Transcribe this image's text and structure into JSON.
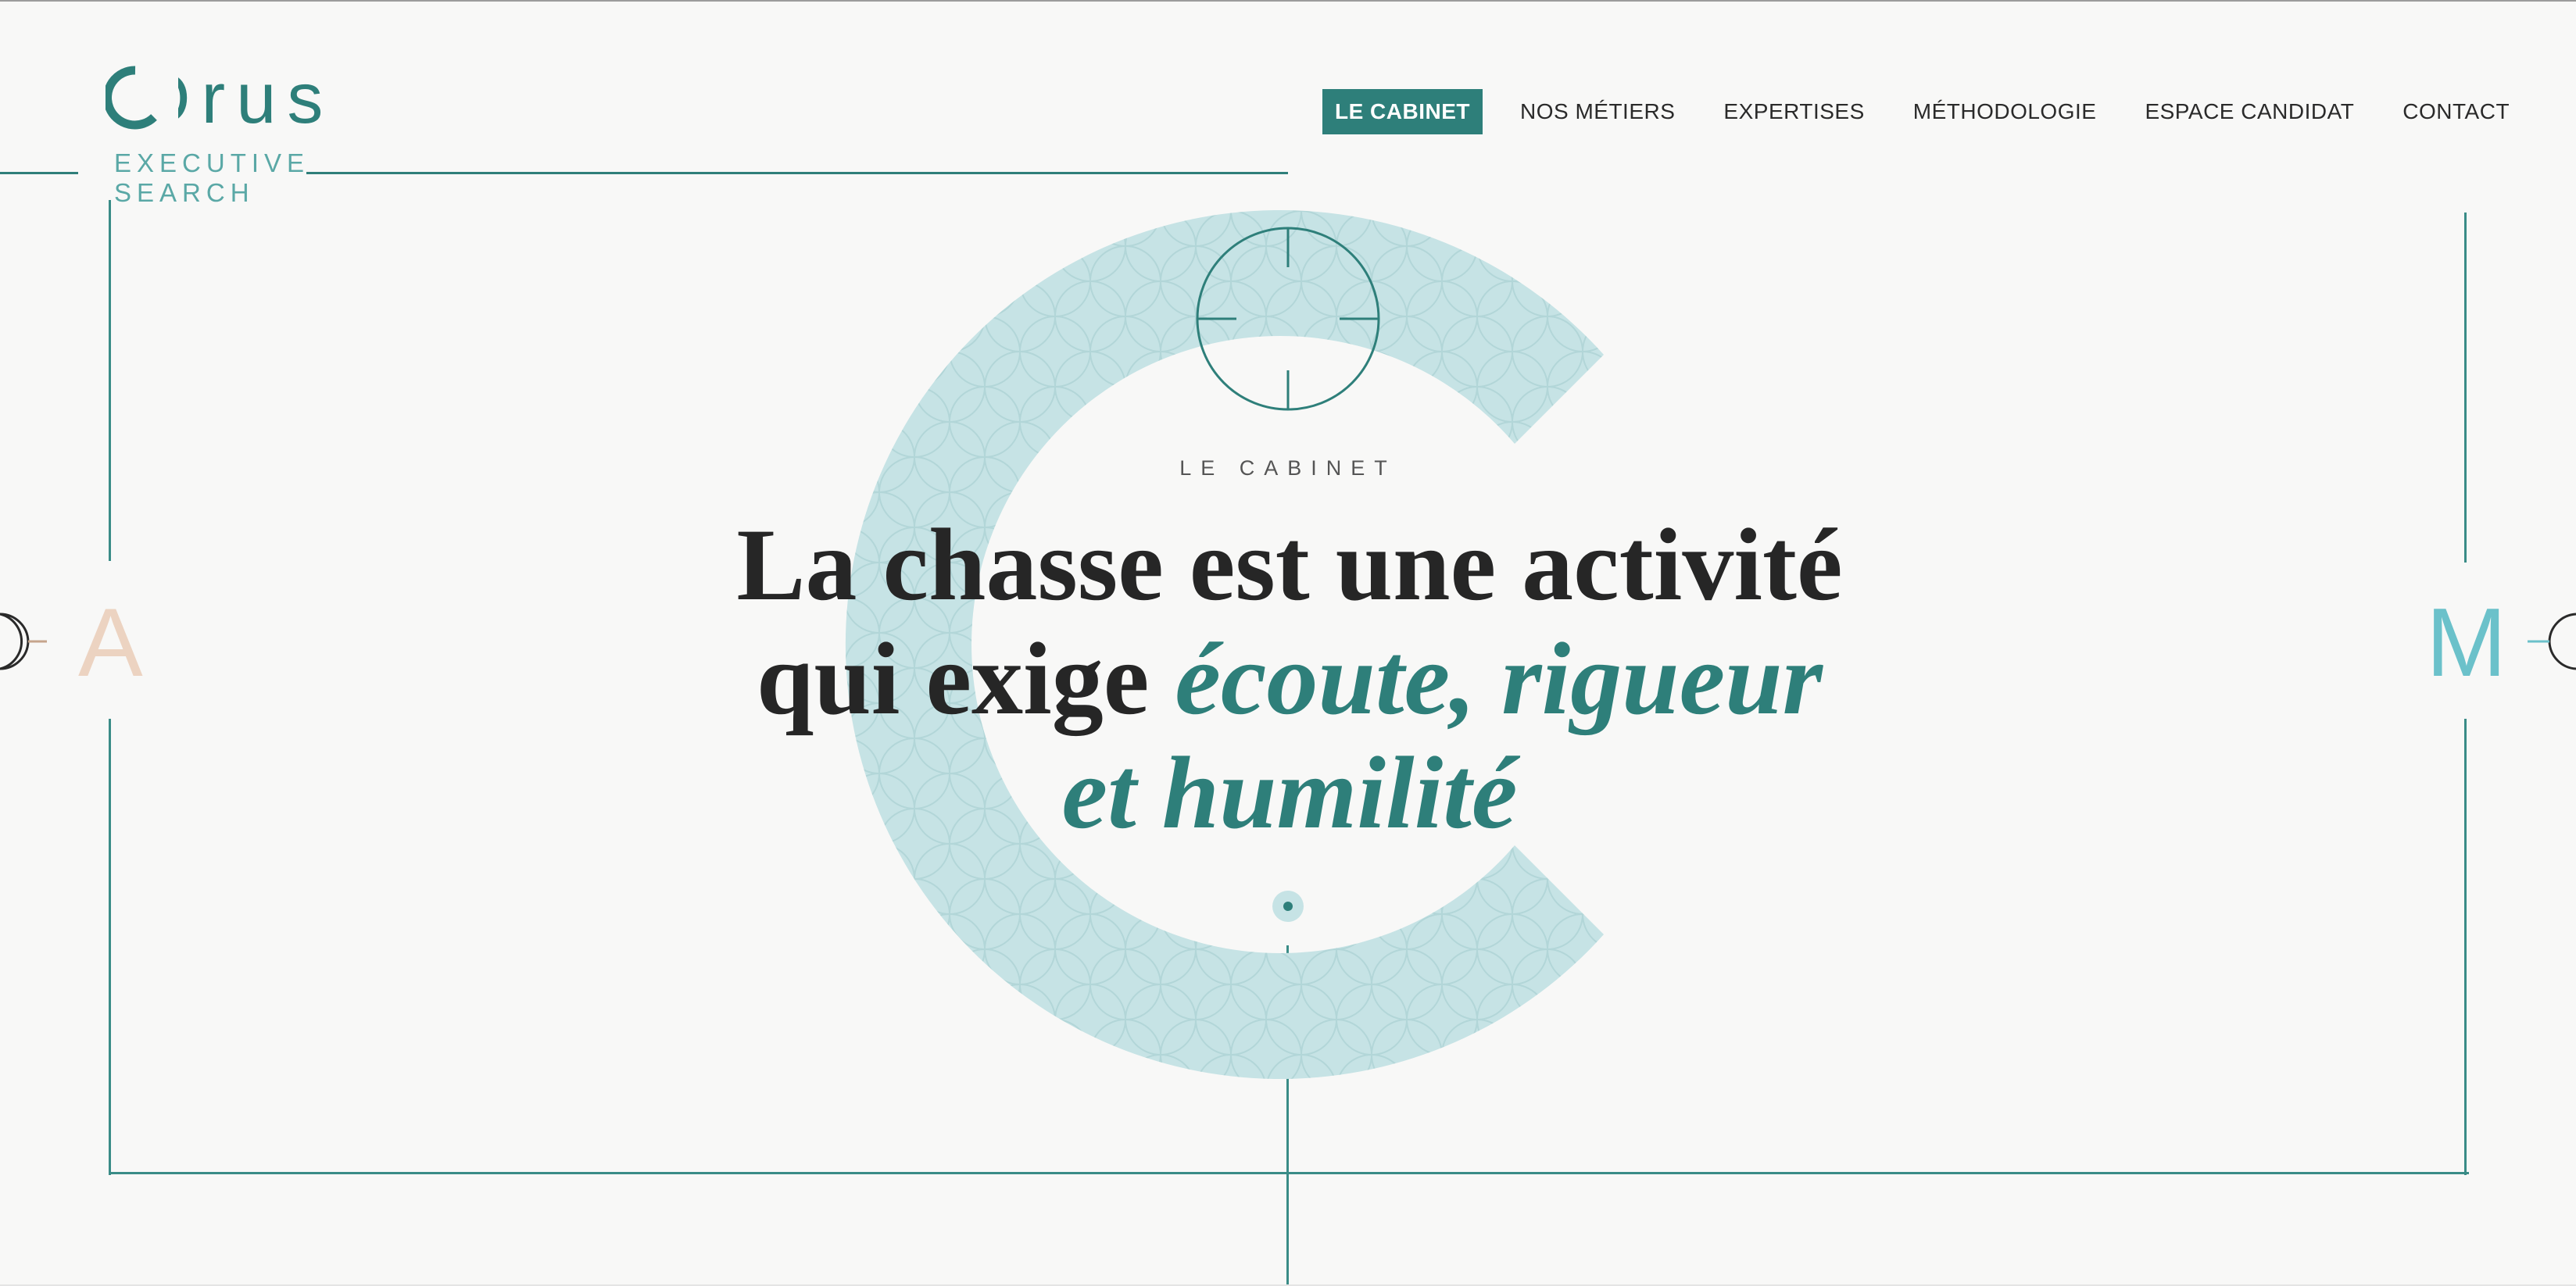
{
  "brand": {
    "name": "Orus",
    "tagline": "EXECUTIVE SEARCH",
    "color": "#2e7f7a"
  },
  "nav": {
    "items": [
      {
        "label": "LE CABINET",
        "active": true
      },
      {
        "label": "NOS MÉTIERS",
        "active": false
      },
      {
        "label": "EXPERTISES",
        "active": false
      },
      {
        "label": "MÉTHODOLOGIE",
        "active": false
      },
      {
        "label": "ESPACE CANDIDAT",
        "active": false
      },
      {
        "label": "CONTACT",
        "active": false
      }
    ]
  },
  "hero": {
    "eyebrow": "LE CABINET",
    "headline_plain_1": "La chasse est une activité",
    "headline_plain_2": "qui exige ",
    "headline_accent_1": "écoute, rigueur",
    "headline_accent_2": "et humilité",
    "big_letter": "C"
  },
  "side_nav": {
    "prev_letter": "A",
    "next_letter": "M"
  },
  "colors": {
    "teal": "#2e7f7a",
    "light_teal": "#c6e3e5",
    "peach": "#ecd3c1",
    "sky": "#6bc1ca"
  }
}
